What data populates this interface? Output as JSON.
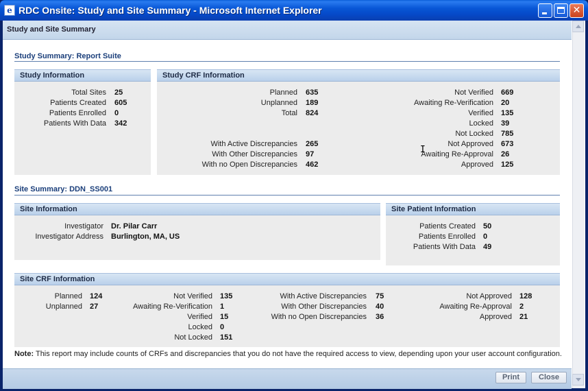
{
  "window": {
    "title": "RDC Onsite: Study and Site Summary - Microsoft Internet Explorer",
    "icon": "ie-page-icon"
  },
  "page": {
    "header": "Study and Site Summary"
  },
  "study_summary": {
    "title": "Study Summary: Report Suite",
    "study_information": {
      "heading": "Study Information",
      "rows": [
        {
          "label": "Total Sites",
          "value": "25"
        },
        {
          "label": "Patients Created",
          "value": "605"
        },
        {
          "label": "Patients Enrolled",
          "value": "0"
        },
        {
          "label": "Patients With Data",
          "value": "342"
        }
      ]
    },
    "study_crf": {
      "heading": "Study CRF Information",
      "left_top": [
        {
          "label": "Planned",
          "value": "635"
        },
        {
          "label": "Unplanned",
          "value": "189"
        },
        {
          "label": "Total",
          "value": "824"
        }
      ],
      "left_bottom": [
        {
          "label": "With Active Discrepancies",
          "value": "265"
        },
        {
          "label": "With Other Discrepancies",
          "value": "97"
        },
        {
          "label": "With no Open Discrepancies",
          "value": "462"
        }
      ],
      "right": [
        {
          "label": "Not Verified",
          "value": "669"
        },
        {
          "label": "Awaiting Re-Verification",
          "value": "20"
        },
        {
          "label": "Verified",
          "value": "135"
        },
        {
          "label": "Locked",
          "value": "39"
        },
        {
          "label": "Not Locked",
          "value": "785"
        },
        {
          "label": "Not Approved",
          "value": "673"
        },
        {
          "label": "Awaiting Re-Approval",
          "value": "26"
        },
        {
          "label": "Approved",
          "value": "125"
        }
      ]
    }
  },
  "site_summary": {
    "title": "Site Summary: DDN_SS001",
    "site_information": {
      "heading": "Site Information",
      "rows": [
        {
          "label": "Investigator",
          "value": "Dr. Pilar Carr"
        },
        {
          "label": "Investigator Address",
          "value": "Burlington, MA, US"
        }
      ]
    },
    "site_patient": {
      "heading": "Site Patient Information",
      "rows": [
        {
          "label": "Patients Created",
          "value": "50"
        },
        {
          "label": "Patients Enrolled",
          "value": "0"
        },
        {
          "label": "Patients With Data",
          "value": "49"
        }
      ]
    },
    "site_crf": {
      "heading": "Site CRF Information",
      "col1": [
        {
          "label": "Planned",
          "value": "124"
        },
        {
          "label": "Unplanned",
          "value": "27"
        }
      ],
      "col2": [
        {
          "label": "Not Verified",
          "value": "135"
        },
        {
          "label": "Awaiting Re-Verification",
          "value": "1"
        },
        {
          "label": "Verified",
          "value": "15"
        },
        {
          "label": "Locked",
          "value": "0"
        },
        {
          "label": "Not Locked",
          "value": "151"
        }
      ],
      "col3": [
        {
          "label": "With Active Discrepancies",
          "value": "75"
        },
        {
          "label": "With Other Discrepancies",
          "value": "40"
        },
        {
          "label": "With no Open Discrepancies",
          "value": "36"
        }
      ],
      "col4": [
        {
          "label": "Not Approved",
          "value": "128"
        },
        {
          "label": "Awaiting Re-Approval",
          "value": "2"
        },
        {
          "label": "Approved",
          "value": "21"
        }
      ]
    }
  },
  "note": {
    "label": "Note:",
    "text": "This report may include counts of CRFs and discrepancies that you do not have the required access to view, depending upon your user account configuration."
  },
  "footer": {
    "print_label": "Print",
    "close_label": "Close"
  },
  "colors": {
    "titlebar": "#0857d6",
    "panel_head": "#c8daee",
    "panel_body": "#ececec",
    "section_title": "#1a3e7a"
  }
}
